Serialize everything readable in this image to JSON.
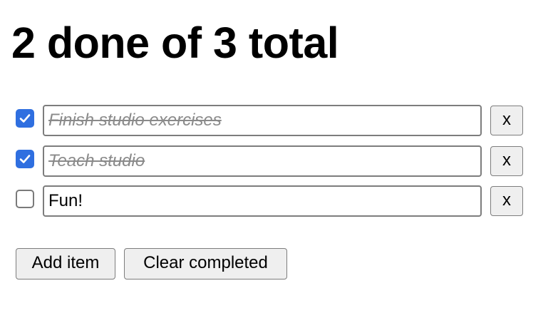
{
  "summary": {
    "done_count": "2",
    "total_count": "3",
    "title": "2 done of 3 total"
  },
  "todos": [
    {
      "text": "Finish studio exercises",
      "checked": true
    },
    {
      "text": "Teach studio",
      "checked": true
    },
    {
      "text": "Fun!",
      "checked": false
    }
  ],
  "delete_label": "x",
  "actions": {
    "add_label": "Add item",
    "clear_label": "Clear completed"
  },
  "colors": {
    "checkbox_checked": "#2f6fe0",
    "done_text": "#8a8a8a",
    "button_bg": "#efefef"
  }
}
